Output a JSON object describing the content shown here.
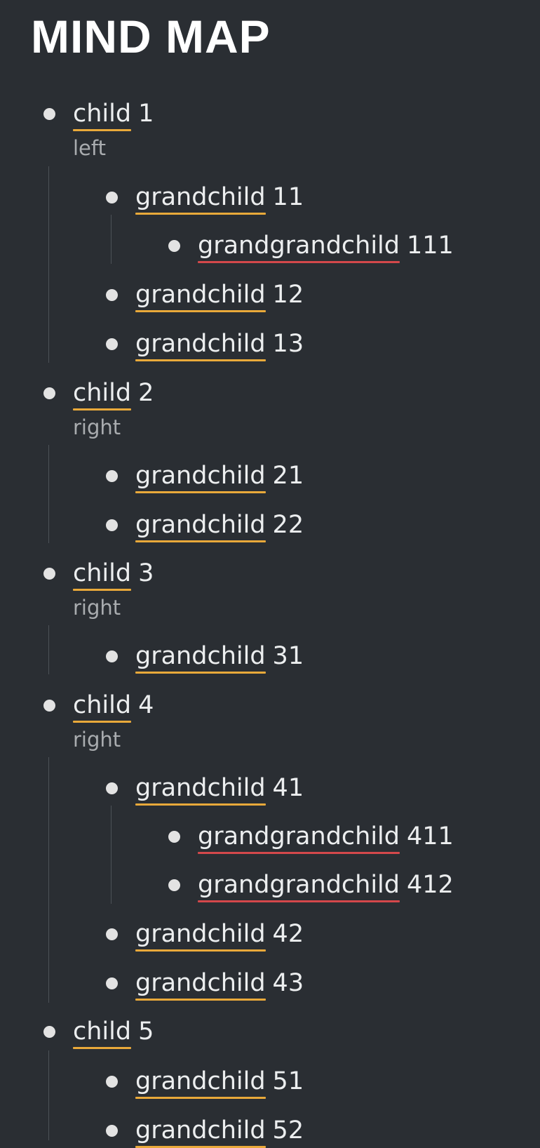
{
  "title": "MIND MAP",
  "nodes": [
    {
      "word": "child",
      "num": "1",
      "note": "left",
      "level": 0
    },
    {
      "word": "grandchild",
      "num": "11",
      "level": 1
    },
    {
      "word": "grandgrandchild",
      "num": "111",
      "level": 2
    },
    {
      "word": "grandchild",
      "num": "12",
      "level": 1
    },
    {
      "word": "grandchild",
      "num": "13",
      "level": 1
    },
    {
      "word": "child",
      "num": "2",
      "note": "right",
      "level": 0
    },
    {
      "word": "grandchild",
      "num": "21",
      "level": 1
    },
    {
      "word": "grandchild",
      "num": "22",
      "level": 1
    },
    {
      "word": "child",
      "num": "3",
      "note": "right",
      "level": 0
    },
    {
      "word": "grandchild",
      "num": "31",
      "level": 1
    },
    {
      "word": "child",
      "num": "4",
      "note": "right",
      "level": 0
    },
    {
      "word": "grandchild",
      "num": "41",
      "level": 1
    },
    {
      "word": "grandgrandchild",
      "num": "411",
      "level": 2
    },
    {
      "word": "grandgrandchild",
      "num": "412",
      "level": 2
    },
    {
      "word": "grandchild",
      "num": "42",
      "level": 1
    },
    {
      "word": "grandchild",
      "num": "43",
      "level": 1
    },
    {
      "word": "child",
      "num": "5",
      "level": 0
    },
    {
      "word": "grandchild",
      "num": "51",
      "level": 1
    },
    {
      "word": "grandchild",
      "num": "52",
      "level": 1
    }
  ],
  "colors": {
    "underline_primary": "#e9a93a",
    "underline_secondary": "#d4484b"
  }
}
